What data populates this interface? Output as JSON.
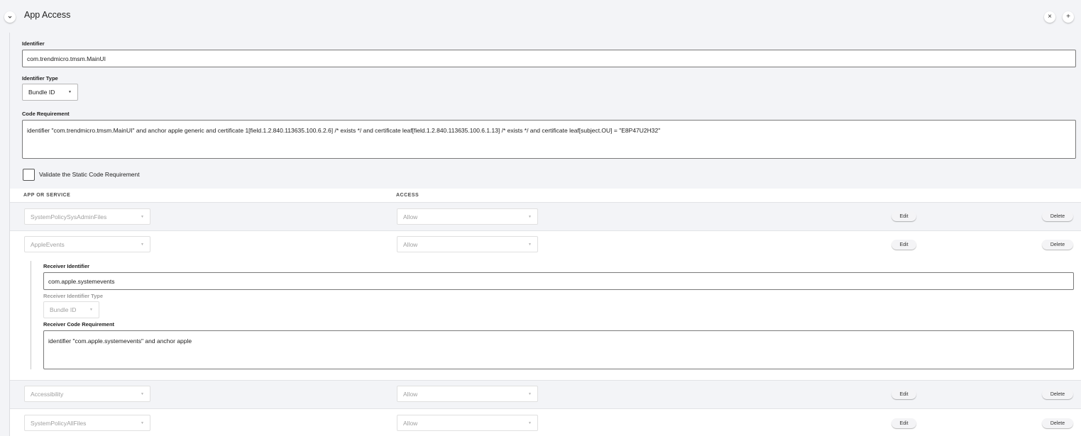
{
  "header": {
    "title": "App Access",
    "collapse_icon": "chevron-down-icon",
    "close_icon": "close-icon",
    "add_icon": "plus-icon",
    "close_glyph": "×",
    "add_glyph": "+",
    "collapse_glyph": "⌄"
  },
  "identifier": {
    "label": "Identifier",
    "value": "com.trendmicro.tmsm.MainUI"
  },
  "identifier_type": {
    "label": "Identifier Type",
    "value": "Bundle ID"
  },
  "code_requirement": {
    "label": "Code Requirement",
    "value": "identifier \"com.trendmicro.tmsm.MainUI\" and anchor apple generic and certificate 1[field.1.2.840.113635.100.6.2.6] /* exists */ and certificate leaf[field.1.2.840.113635.100.6.1.13] /* exists */ and certificate leaf[subject.OU] = \"E8P47U2H32\""
  },
  "validate_static": {
    "label": "Validate the Static Code Requirement",
    "checked": false
  },
  "table": {
    "columns": [
      "APP OR SERVICE",
      "ACCESS"
    ],
    "edit_label": "Edit",
    "delete_label": "Delete",
    "rows": [
      {
        "service": "SystemPolicySysAdminFiles",
        "access": "Allow"
      },
      {
        "service": "AppleEvents",
        "access": "Allow"
      },
      {
        "service": "Accessibility",
        "access": "Allow"
      },
      {
        "service": "SystemPolicyAllFiles",
        "access": "Allow"
      }
    ]
  },
  "apple_events": {
    "receiver_identifier_label": "Receiver Identifier",
    "receiver_identifier_value": "com.apple.systemevents",
    "receiver_identifier_type_label": "Receiver Identifier Type",
    "receiver_identifier_type_value": "Bundle ID",
    "receiver_code_requirement_label": "Receiver Code Requirement",
    "receiver_code_requirement_value": "identifier \"com.apple.systemevents\" and anchor apple"
  },
  "caret_glyph": "▼"
}
